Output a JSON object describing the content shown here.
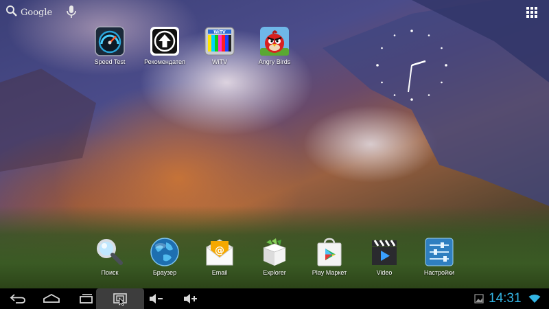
{
  "search": {
    "label": "Google"
  },
  "apps_top": [
    {
      "label": "Speed Test",
      "icon": "speedometer-icon"
    },
    {
      "label": "Рекомендател",
      "icon": "upload-arrow-icon"
    },
    {
      "label": "WiTV",
      "icon": "tv-icon"
    },
    {
      "label": "Angry Birds",
      "icon": "angry-bird-icon"
    }
  ],
  "apps_dock": [
    {
      "label": "Поиск",
      "icon": "magnifier-icon"
    },
    {
      "label": "Браузер",
      "icon": "globe-icon"
    },
    {
      "label": "Email",
      "icon": "email-icon"
    },
    {
      "label": "Explorer",
      "icon": "box-icon"
    },
    {
      "label": "Play Маркет",
      "icon": "play-store-icon"
    },
    {
      "label": "Video",
      "icon": "video-clapper-icon"
    },
    {
      "label": "Настройки",
      "icon": "settings-sliders-icon"
    }
  ],
  "navbar": {
    "buttons": [
      "back",
      "home",
      "recent-apps",
      "screenshot",
      "volume-down",
      "volume-up"
    ],
    "time": "14:31"
  },
  "colors": {
    "accent": "#33b5e5",
    "navbar": "#000000"
  }
}
